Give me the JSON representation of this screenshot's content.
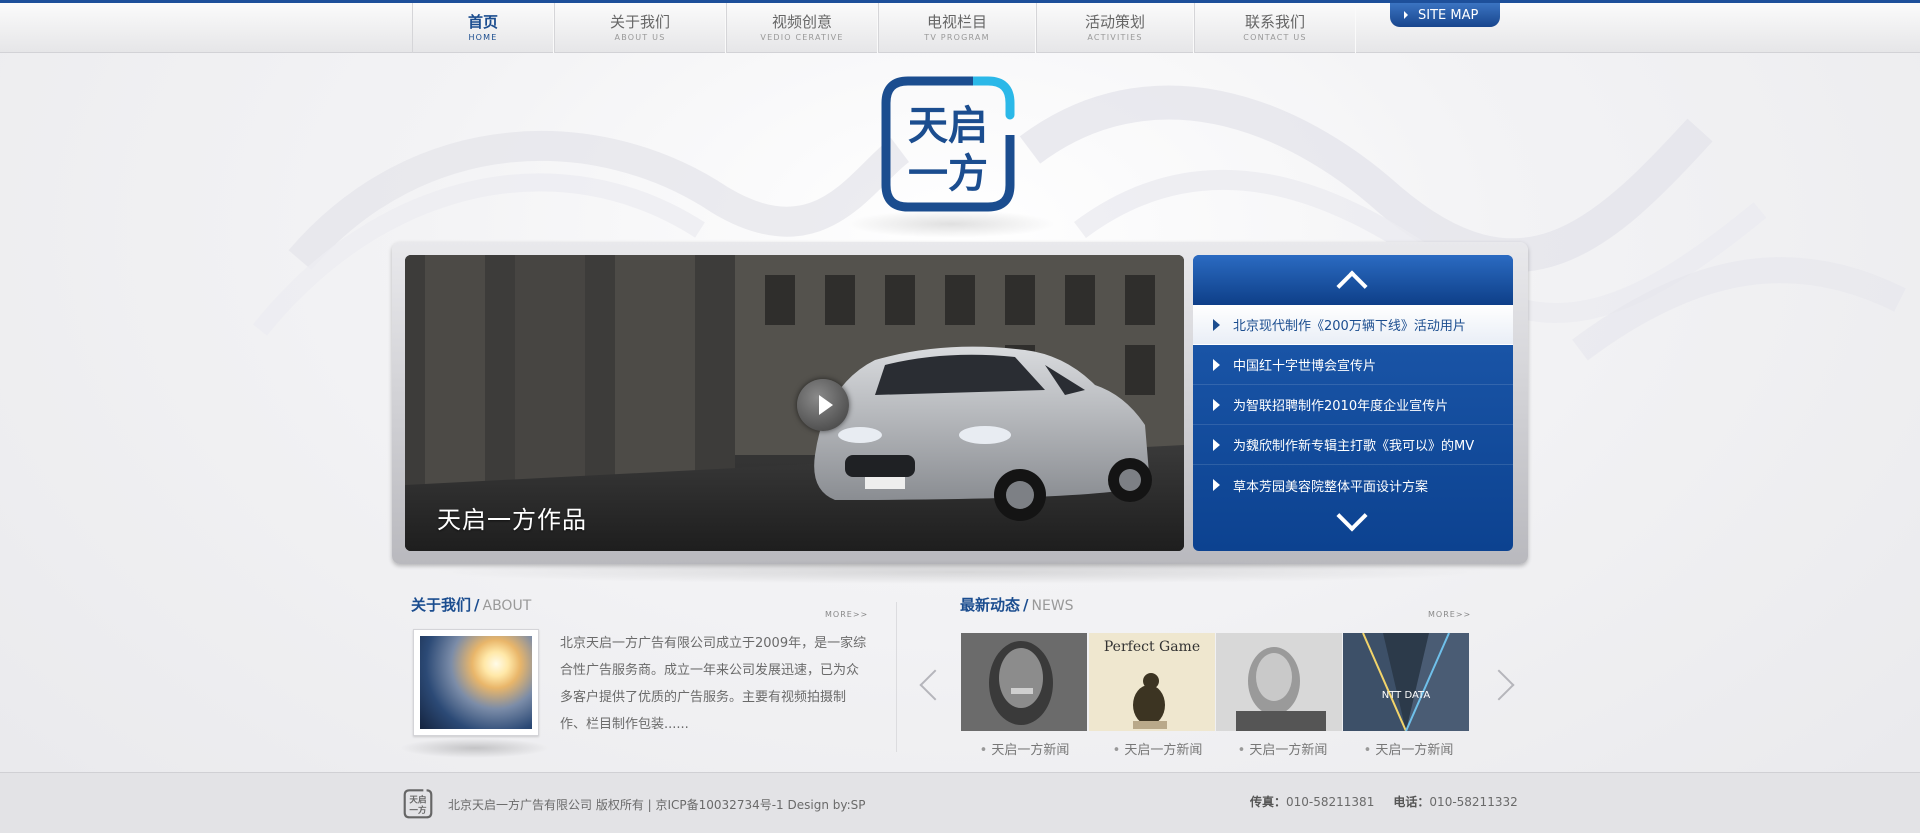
{
  "nav": {
    "items": [
      {
        "zh": "首页",
        "en": "HOME",
        "active": true
      },
      {
        "zh": "关于我们",
        "en": "ABOUT US"
      },
      {
        "zh": "视频创意",
        "en": "VEDIO CERATIVE"
      },
      {
        "zh": "电视栏目",
        "en": "TV PROGRAM"
      },
      {
        "zh": "活动策划",
        "en": "ACTIVITIES"
      },
      {
        "zh": "联系我们",
        "en": "CONTACT US"
      }
    ],
    "sitemap_label": "SITE MAP"
  },
  "logo": {
    "line1": "天启",
    "line2": "一方"
  },
  "slider": {
    "caption": "天启一方作品",
    "list": [
      "北京现代制作《200万辆下线》活动用片",
      "中国红十字世博会宣传片",
      "为智联招聘制作2010年度企业宣传片",
      "为魏欣制作新专辑主打歌《我可以》的MV",
      "草本芳园美容院整体平面设计方案"
    ]
  },
  "about": {
    "title_zh": "关于我们",
    "slash": "/",
    "title_en": "ABOUT",
    "more": "MORE>>",
    "text": "北京天启一方广告有限公司成立于2009年，是一家综合性广告服务商。成立一年来公司发展迅速，已为众多客户提供了优质的广告服务。主要有视频拍摄制作、栏目制作包装......"
  },
  "news": {
    "title_zh": "最新动态",
    "slash": "/",
    "title_en": "NEWS",
    "more": "MORE>>",
    "items": [
      {
        "caption": "天启一方新闻"
      },
      {
        "caption": "天启一方新闻",
        "poster_title": "Perfect Game"
      },
      {
        "caption": "天启一方新闻"
      },
      {
        "caption": "天启一方新闻",
        "poster_title": "NTT DATA"
      }
    ]
  },
  "footer": {
    "copyright": "北京天启一方广告有限公司  版权所有  |  京ICP备10032734号-1  Design by:SP",
    "fax_label": "传真：",
    "fax": "010-58211381",
    "tel_label": "电话：",
    "tel": "010-58211332"
  },
  "colors": {
    "brand": "#1b4d8f",
    "accent": "#2bb8e8",
    "list_bg": "#0c4290"
  }
}
